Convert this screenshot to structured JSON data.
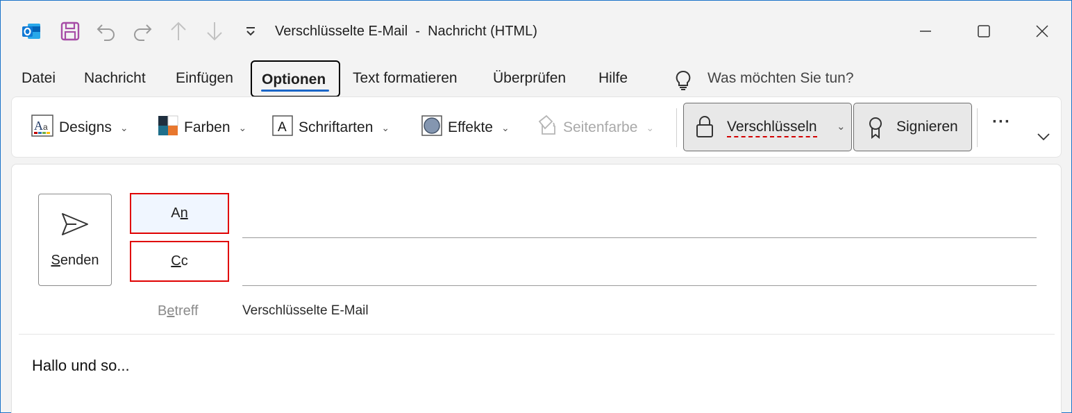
{
  "window": {
    "title": "Verschlüsselte E-Mail  -  Nachricht (HTML)"
  },
  "quick_access": {
    "icons": [
      "outlook-icon",
      "save-icon",
      "undo-icon",
      "redo-icon",
      "up-icon",
      "down-icon",
      "customize-icon"
    ]
  },
  "tabs": {
    "datei": "Datei",
    "nachricht": "Nachricht",
    "einfuegen": "Einfügen",
    "optionen": "Optionen",
    "text_formatieren": "Text formatieren",
    "ueberpruefen": "Überprüfen",
    "hilfe": "Hilfe",
    "search_placeholder": "Was möchten Sie tun?"
  },
  "ribbon": {
    "designs": "Designs",
    "farben": "Farben",
    "schriftarten": "Schriftarten",
    "effekte": "Effekte",
    "seitenfarbe": "Seitenfarbe",
    "verschluesseln": "Verschlüsseln",
    "signieren": "Signieren",
    "more": "···"
  },
  "compose": {
    "send_label_first": "S",
    "send_label_rest": "enden",
    "to_label_a": "A",
    "to_label_n": "n",
    "cc_label_c1": "C",
    "cc_label_c2": "c",
    "subject_label_a": "B",
    "subject_label_u": "e",
    "subject_label_b": "treff",
    "subject_value": "Verschlüsselte E-Mail",
    "body": "Hallo und so..."
  },
  "colors": {
    "accent": "#1a66c8",
    "highlight_border": "#e00000",
    "spell_error": "#d40000"
  }
}
